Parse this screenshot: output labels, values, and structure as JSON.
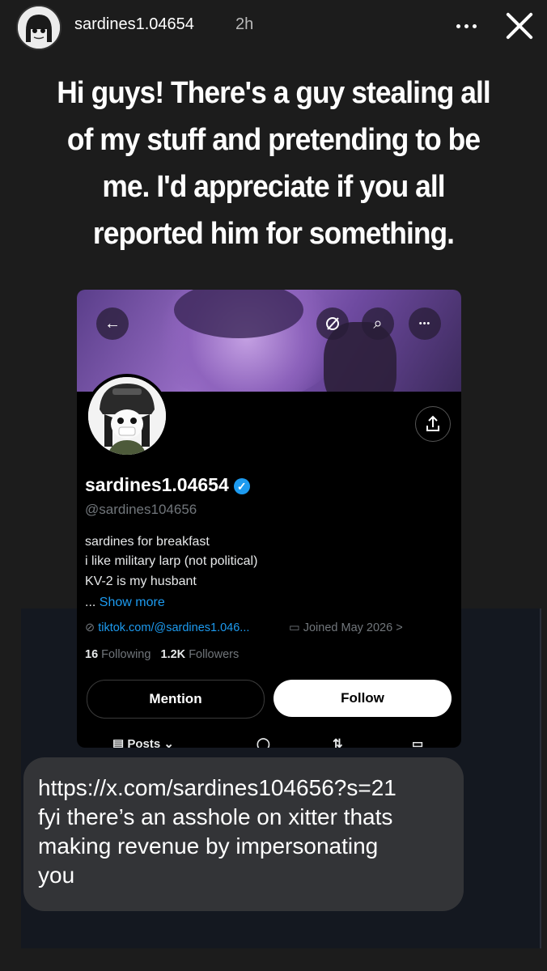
{
  "story_header": {
    "username": "sardines1.04654",
    "time": "2h",
    "more_icon": "more-horizontal-icon",
    "close_icon": "close-icon"
  },
  "caption": {
    "lines": [
      "Hi guys! There's a guy stealing all",
      "of my stuff and pretending to be",
      "me. I'd appreciate if you all",
      "reported him for something."
    ]
  },
  "profile": {
    "display_name": "sardines1.04654",
    "verified_icon": "verified-check-icon",
    "verified_glyph": "✓",
    "handle": "@sardines104656",
    "bio": [
      "sardines for breakfast",
      "i like military larp (not political)",
      "KV-2 is my husbant"
    ],
    "show_more_prefix": "...",
    "show_more": "Show more",
    "link": "tiktok.com/@sardines1.046...",
    "joined": "Joined May 2026",
    "joined_chevron": ">",
    "following_count": "16",
    "following_label": "Following",
    "followers_count": "1.2K",
    "followers_label": "Followers",
    "mention_label": "Mention",
    "follow_label": "Follow",
    "back_glyph": "←",
    "search_glyph": "⌕",
    "more_glyph": "•••",
    "tabs": [
      "Posts",
      "",
      "",
      ""
    ]
  },
  "message": {
    "lines": [
      "https://x.com/sardines104656?s=21",
      "fyi there’s an asshole on xitter thats",
      "making revenue by impersonating",
      "you"
    ]
  },
  "colors": {
    "background": "#1c1c1c",
    "verified_blue": "#1d9bf0",
    "bubble": "#333437"
  }
}
